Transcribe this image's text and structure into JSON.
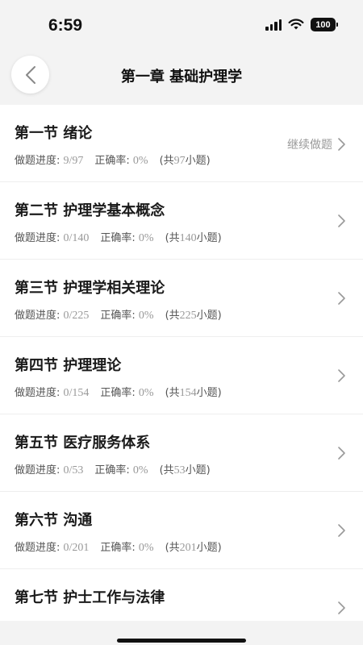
{
  "status_bar": {
    "time": "6:59",
    "battery": "100"
  },
  "nav": {
    "title": "第一章 基础护理学"
  },
  "labels": {
    "progress_prefix": "做题进度: ",
    "accuracy_prefix": "正确率: ",
    "total_open": "(共",
    "total_close": "小题)",
    "continue_label": "继续做题"
  },
  "sections": [
    {
      "title": "第一节 绪论",
      "progress": "9/97",
      "accuracy": "0%",
      "total": "97"
    },
    {
      "title": "第二节 护理学基本概念",
      "progress": "0/140",
      "accuracy": "0%",
      "total": "140"
    },
    {
      "title": "第三节 护理学相关理论",
      "progress": "0/225",
      "accuracy": "0%",
      "total": "225"
    },
    {
      "title": "第四节 护理理论",
      "progress": "0/154",
      "accuracy": "0%",
      "total": "154"
    },
    {
      "title": "第五节 医疗服务体系",
      "progress": "0/53",
      "accuracy": "0%",
      "total": "53"
    },
    {
      "title": "第六节 沟通",
      "progress": "0/201",
      "accuracy": "0%",
      "total": "201"
    },
    {
      "title": "第七节 护士工作与法律",
      "progress": "",
      "accuracy": "",
      "total": ""
    }
  ],
  "icons": {
    "back": "chevron-left-icon",
    "row": "chevron-right-icon"
  },
  "colors": {
    "background": "#f3f3f3",
    "card": "#ffffff",
    "muted": "#999999"
  }
}
